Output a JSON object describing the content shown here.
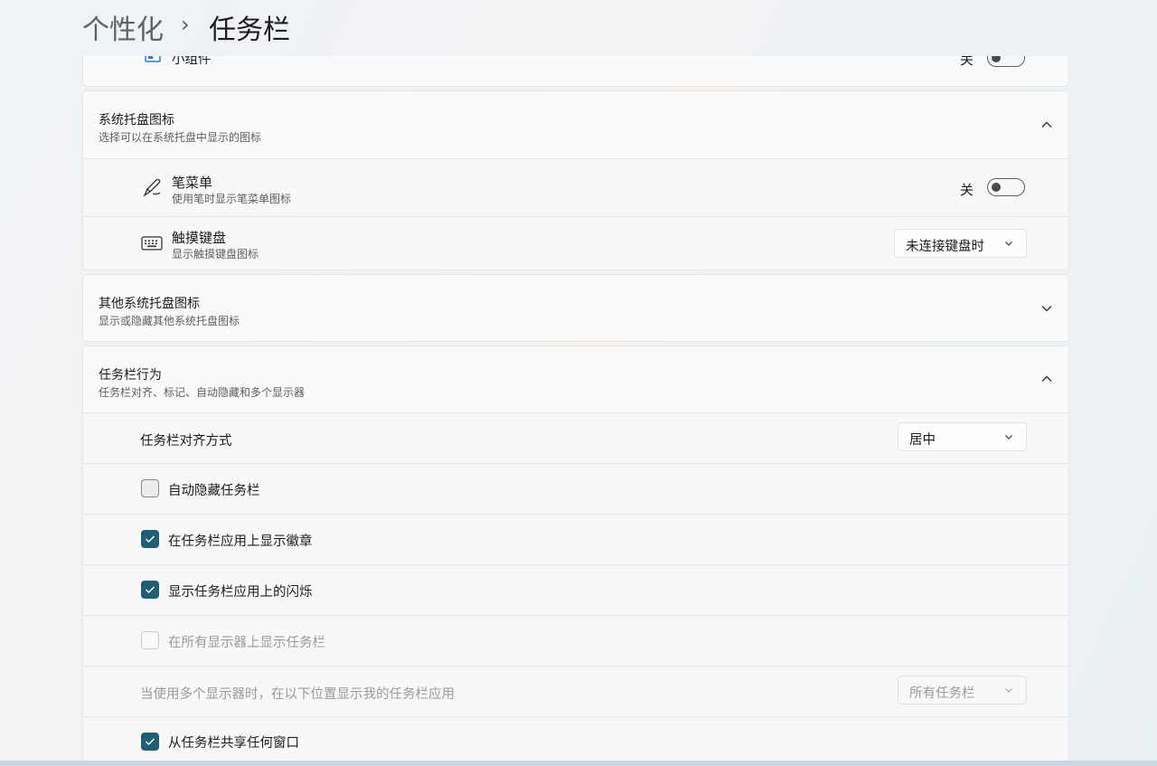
{
  "breadcrumb": {
    "parent": "个性化",
    "separator": "›",
    "current": "任务栏"
  },
  "top_partial": {
    "label": "小组件",
    "toggle_state_label": "关",
    "toggle_on": false
  },
  "system_tray": {
    "title": "系统托盘图标",
    "subtitle": "选择可以在系统托盘中显示的图标",
    "expanded": true,
    "items": [
      {
        "title": "笔菜单",
        "subtitle": "使用笔时显示笔菜单图标",
        "icon": "pen-icon",
        "toggle_state_label": "关",
        "toggle_on": false
      },
      {
        "title": "触摸键盘",
        "subtitle": "显示触摸键盘图标",
        "icon": "keyboard-icon",
        "dropdown_value": "未连接键盘时"
      }
    ]
  },
  "other_tray": {
    "title": "其他系统托盘图标",
    "subtitle": "显示或隐藏其他系统托盘图标",
    "expanded": false
  },
  "behavior": {
    "title": "任务栏行为",
    "subtitle": "任务栏对齐、标记、自动隐藏和多个显示器",
    "expanded": true,
    "alignment_label": "任务栏对齐方式",
    "alignment_value": "居中",
    "checkboxes": [
      {
        "label": "自动隐藏任务栏",
        "checked": false,
        "disabled": false
      },
      {
        "label": "在任务栏应用上显示徽章",
        "checked": true,
        "disabled": false
      },
      {
        "label": "显示任务栏应用上的闪烁",
        "checked": true,
        "disabled": false
      },
      {
        "label": "在所有显示器上显示任务栏",
        "checked": false,
        "disabled": true
      }
    ],
    "multi_display_label": "当使用多个显示器时，在以下位置显示我的任务栏应用",
    "multi_display_value": "所有任务栏",
    "multi_display_disabled": true,
    "share_window": {
      "label": "从任务栏共享任何窗口",
      "checked": true
    }
  },
  "colors": {
    "accent": "#1f5e73",
    "disabled_text": "#9a9a9a"
  }
}
